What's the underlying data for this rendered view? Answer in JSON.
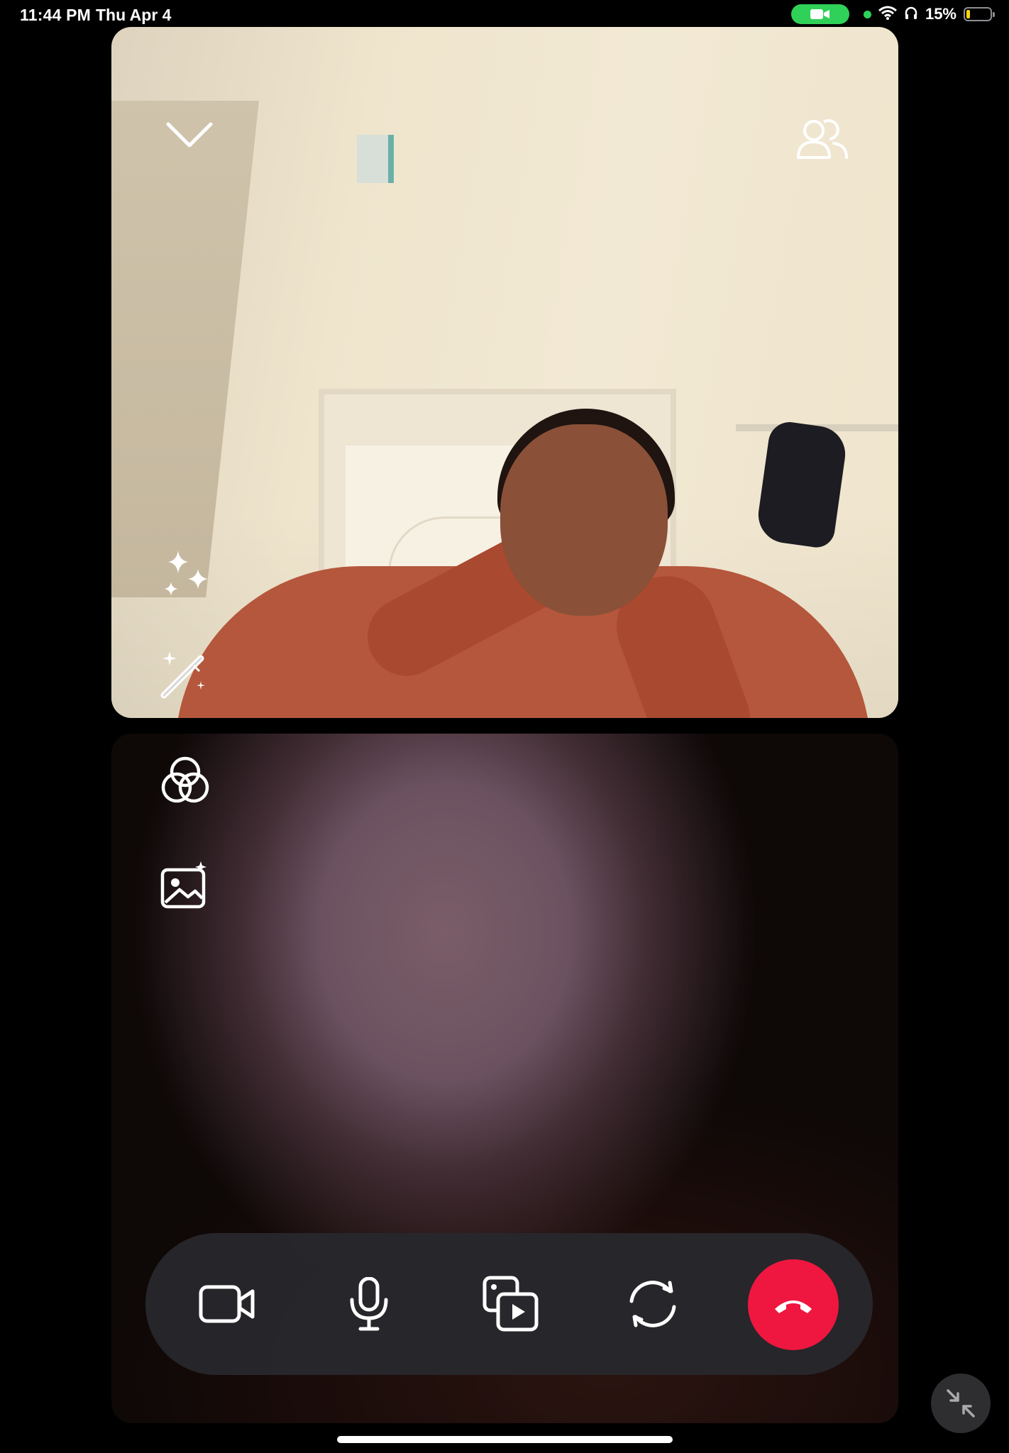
{
  "status_bar": {
    "time": "11:44 PM",
    "date": "Thu Apr 4",
    "battery_percent": "15%",
    "battery_level": 0.15,
    "icons": [
      "camera-in-use-icon",
      "privacy-indicator-dot",
      "wifi-icon",
      "headphones-icon",
      "battery-icon"
    ],
    "colors": {
      "camera_pill": "#30d158",
      "battery_fill": "#ffd60a"
    }
  },
  "remote_video": {
    "icons": [
      "chevron-down-icon",
      "participants-icon",
      "sparkles-effects-icon",
      "magic-wand-icon"
    ]
  },
  "local_video": {
    "icons": [
      "filters-icon",
      "background-image-icon"
    ]
  },
  "controls": {
    "buttons": [
      "camera-icon",
      "microphone-icon",
      "share-media-icon",
      "flip-camera-icon",
      "end-call-icon"
    ],
    "end_call_color": "#ef1740"
  },
  "pip": {
    "icon": "minimize-arrows-icon"
  }
}
